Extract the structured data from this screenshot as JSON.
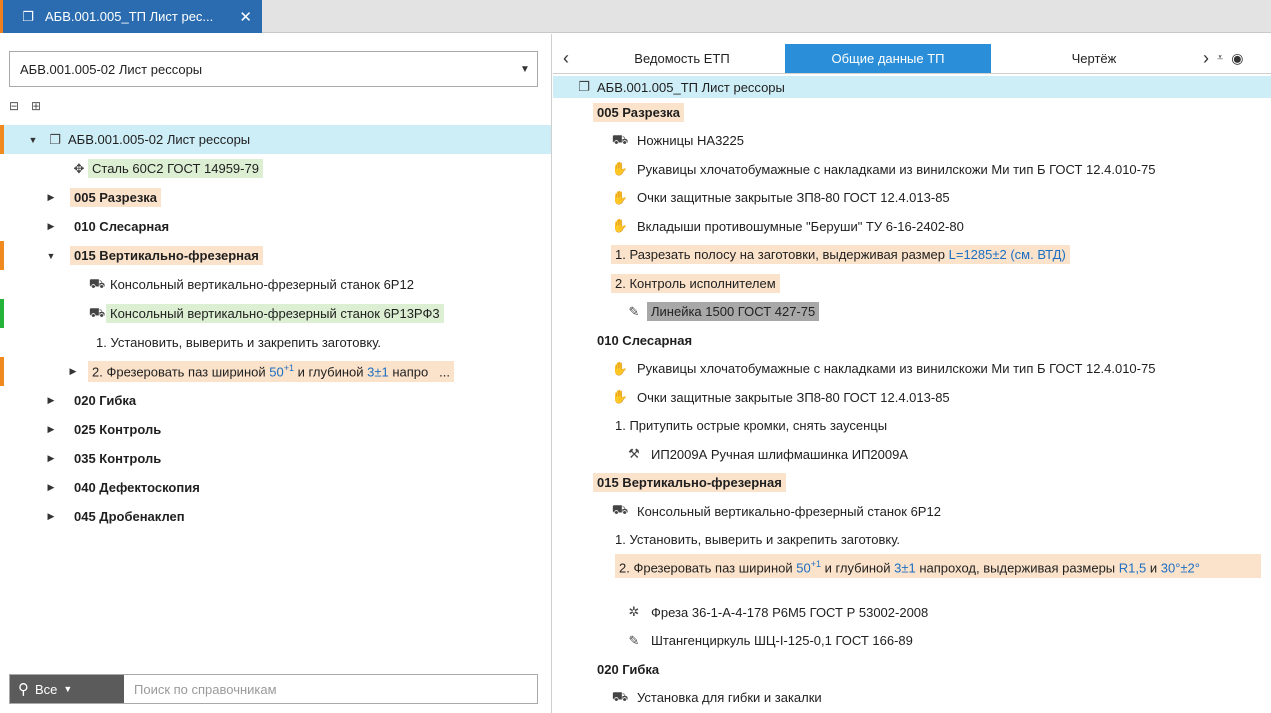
{
  "doc_tab": {
    "title": "АБВ.001.005_ТП Лист рес...",
    "close": "✕"
  },
  "left": {
    "select_value": "АБВ.001.005-02 Лист рессоры",
    "tree": {
      "root": "АБВ.001.005-02 Лист рессоры",
      "material": "Сталь 60С2 ГОСТ 14959-79",
      "op005": "005 Разрезка",
      "op010": "010 Слесарная",
      "op015": "015 Вертикально-фрезерная",
      "eq1": "Консольный вертикально-фрезерный станок 6Р12",
      "eq2": "Консольный вертикально-фрезерный станок 6Р13РФ3",
      "step1": "1. Установить, выверить и закрепить заготовку.",
      "step2_a": "2. Фрезеровать паз шириной ",
      "step2_b": "50",
      "step2_sup": "+1",
      "step2_c": " и глубиной ",
      "step2_d": "3±1",
      "step2_e": " напро",
      "step2_more": "...",
      "op020": "020 Гибка",
      "op025": "025 Контроль",
      "op035": "035 Контроль",
      "op040": "040 Дефектоскопия",
      "op045": "045 Дробенаклеп"
    },
    "search": {
      "scope": "Все",
      "placeholder": "Поиск по справочникам"
    }
  },
  "right": {
    "tabs": [
      "Ведомость ЕТП",
      "Общие данные ТП",
      "Чертёж"
    ],
    "header": "АБВ.001.005_ТП Лист рессоры",
    "op005": "005 Разрезка",
    "r1": "Ножницы НА3225",
    "r2": "Рукавицы хлочатобумажные с накладками из винилскожи  Ми тип Б ГОСТ 12.4.010-75",
    "r3": "Очки защитные закрытые ЗП8-80 ГОСТ 12.4.013-85",
    "r4": "Вкладыши противошумные \"Беруши\" ТУ 6-16-2402-80",
    "r5_a": "1. Разрезать полосу на заготовки, выдерживая размер ",
    "r5_b": "L=1285±2 (см. ВТД)",
    "r6": "2. Контроль исполнителем",
    "r7": "Линейка 1500 ГОСТ 427-75",
    "op010": "010 Слесарная",
    "r8": "Рукавицы хлочатобумажные с накладками из винилскожи  Ми тип Б ГОСТ 12.4.010-75",
    "r9": "Очки защитные закрытые ЗП8-80 ГОСТ 12.4.013-85",
    "r10": "1. Притупить острые кромки, снять заусенцы",
    "r11": "ИП2009А Ручная шлифмашинка ИП2009А",
    "op015": "015 Вертикально-фрезерная",
    "r12": "Консольный вертикально-фрезерный станок 6Р12",
    "r13": "1. Установить, выверить и закрепить заготовку.",
    "r14_a": "2. Фрезеровать паз шириной ",
    "r14_b": "50",
    "r14_sup": "+1",
    "r14_c": " и глубиной ",
    "r14_d": "3±1",
    "r14_e": " напроход, выдерживая размеры ",
    "r14_f": "R1,5",
    "r14_g": " и ",
    "r14_h": "30°±2°",
    "r15": "Фреза 36-1-А-4-178 Р6М5 ГОСТ Р 53002-2008",
    "r16": "Штангенциркуль ШЦ-I-125-0,1 ГОСТ 166-89",
    "op020": "020 Гибка",
    "r17": "Установка для гибки и закалки"
  }
}
